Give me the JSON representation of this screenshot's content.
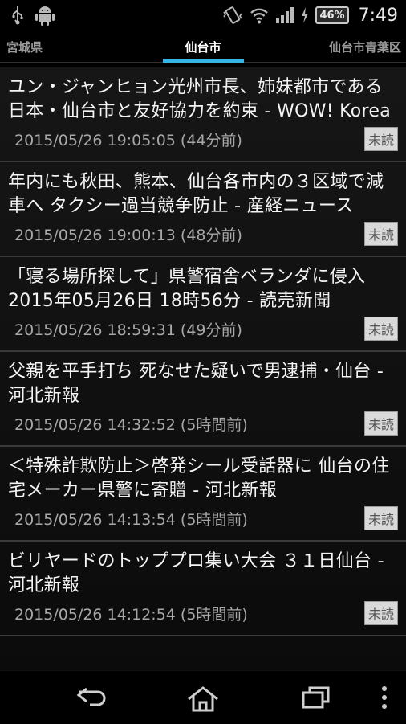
{
  "status_bar": {
    "battery": "46%",
    "time": "7:49",
    "icons": [
      "usb-icon",
      "android-icon",
      "vibrate-icon",
      "wifi-icon",
      "signal-icon",
      "charging-icon"
    ]
  },
  "tabs": {
    "left": "宮城県",
    "center": "仙台市",
    "right": "仙台市青葉区",
    "accent": "#33b5e5"
  },
  "news": [
    {
      "title": "ユン・ジャンヒョン光州市長、姉妹都市である日本・仙台市と友好協力を約束 - WOW! Korea",
      "datetime": "2015/05/26 19:05:05 (44分前)",
      "badge": "未読"
    },
    {
      "title": "年内にも秋田、熊本、仙台各市内の３区域で減車へ タクシー過当競争防止 - 産経ニュース",
      "datetime": "2015/05/26 19:00:13 (48分前)",
      "badge": "未読"
    },
    {
      "title": "「寝る場所探して」県警宿舎ベランダに侵入 2015年05月26日 18時56分 - 読売新聞",
      "datetime": "2015/05/26 18:59:31 (49分前)",
      "badge": "未読"
    },
    {
      "title": "父親を平手打ち 死なせた疑いで男逮捕・仙台 - 河北新報",
      "datetime": "2015/05/26 14:32:52 (5時間前)",
      "badge": "未読"
    },
    {
      "title": "＜特殊詐欺防止＞啓発シール受話器に 仙台の住宅メーカー県警に寄贈 - 河北新報",
      "datetime": "2015/05/26 14:13:54 (5時間前)",
      "badge": "未読"
    },
    {
      "title": "ビリヤードのトッププロ集い大会 ３１日仙台 - 河北新報",
      "datetime": "2015/05/26 14:12:54 (5時間前)",
      "badge": "未読"
    }
  ],
  "nav_bar": {
    "icons": [
      "back-icon",
      "home-icon",
      "recents-icon",
      "overflow-menu-icon"
    ]
  }
}
